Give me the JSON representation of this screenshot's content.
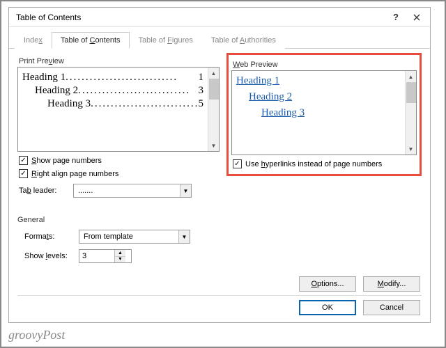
{
  "title": "Table of Contents",
  "tabs": {
    "index": "Index",
    "toc": "Table of Contents",
    "figures": "Table of Figures",
    "authorities": "Table of Authorities"
  },
  "print_preview": {
    "label": "Print Preview",
    "lines": [
      {
        "text": "Heading 1",
        "page": "1"
      },
      {
        "text": "Heading 2",
        "page": "3"
      },
      {
        "text": "Heading 3",
        "page": "5"
      }
    ],
    "leader": "............................"
  },
  "web_preview": {
    "label": "Web Preview",
    "items": [
      "Heading 1",
      "Heading 2",
      "Heading 3"
    ]
  },
  "checks": {
    "show_page_numbers": "Show page numbers",
    "right_align": "Right align page numbers",
    "use_hyperlinks": "Use hyperlinks instead of page numbers"
  },
  "tab_leader": {
    "label": "Tab leader:",
    "value": "......."
  },
  "general": {
    "label": "General",
    "formats_label": "Formats:",
    "formats_value": "From template",
    "levels_label": "Show levels:",
    "levels_value": "3"
  },
  "buttons": {
    "options": "Options...",
    "modify": "Modify...",
    "ok": "OK",
    "cancel": "Cancel"
  },
  "watermark": "groovyPost"
}
